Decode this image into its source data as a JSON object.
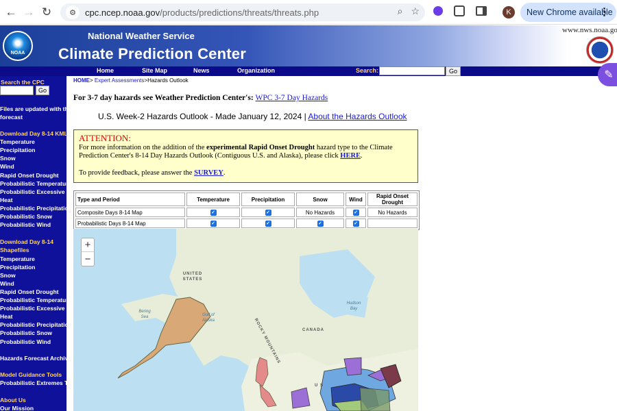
{
  "browser": {
    "url_host": "cpc.ncep.noaa.gov",
    "url_path": "/products/predictions/threats/threats.php",
    "profile_initial": "K",
    "update_label": "New Chrome available"
  },
  "header": {
    "logo_text": "NOAA",
    "agency": "National Weather Service",
    "title": "Climate Prediction Center",
    "site_url": "www.nws.noaa.gov"
  },
  "navbar": {
    "links": [
      "Home",
      "Site Map",
      "News",
      "Organization"
    ],
    "search_label": "Search:",
    "go_label": "Go"
  },
  "sidebar": {
    "search_label": "Search the CPC",
    "go_label": "Go",
    "items": [
      {
        "label": "Files are updated with the",
        "head": false
      },
      {
        "label": "forecast",
        "head": false
      },
      {
        "label": "Download Day 8-14 KML",
        "head": true
      },
      {
        "label": "Temperature",
        "head": false
      },
      {
        "label": "Precipitation",
        "head": false
      },
      {
        "label": "Snow",
        "head": false
      },
      {
        "label": "Wind",
        "head": false
      },
      {
        "label": "Rapid Onset Drought",
        "head": false
      },
      {
        "label": "Probabilistic Temperature",
        "head": false
      },
      {
        "label": "Probabilistic Excessive",
        "head": false
      },
      {
        "label": "Heat",
        "head": false
      },
      {
        "label": "Probabilistic Precipitation",
        "head": false
      },
      {
        "label": "Probabilistic Snow",
        "head": false
      },
      {
        "label": "Probabilistic Wind",
        "head": false
      },
      {
        "label": "Download Day 8-14",
        "head": true
      },
      {
        "label": "Shapefiles",
        "head": true
      },
      {
        "label": "Temperature",
        "head": false
      },
      {
        "label": "Precipitation",
        "head": false
      },
      {
        "label": "Snow",
        "head": false
      },
      {
        "label": "Wind",
        "head": false
      },
      {
        "label": "Rapid Onset Drought",
        "head": false
      },
      {
        "label": "Probabilistic Temperature",
        "head": false
      },
      {
        "label": "Probabilistic Excessive",
        "head": false
      },
      {
        "label": "Heat",
        "head": false
      },
      {
        "label": "Probabilistic Precipitation",
        "head": false
      },
      {
        "label": "Probabilistic Snow",
        "head": false
      },
      {
        "label": "Probabilistic Wind",
        "head": false
      },
      {
        "label": "Hazards Forecast Archives",
        "head": false
      },
      {
        "label": "Model Guidance Tools",
        "head": true
      },
      {
        "label": "Probabilistic Extremes Tool",
        "head": false
      },
      {
        "label": "About Us",
        "head": true
      },
      {
        "label": "Our Mission",
        "head": false
      }
    ]
  },
  "breadcrumb": {
    "home": "HOME",
    "sep": ">",
    "expert": "Expert Assessments",
    "current": "Hazards Outlook"
  },
  "wpc": {
    "prefix": "For 3-7 day hazards see Weather Prediction Center's:",
    "link": "WPC 3-7 Day Hazards"
  },
  "outlook": {
    "title": "U.S. Week-2 Hazards Outlook - Made January 12, 2024",
    "sep": "|",
    "about_link": "About the Hazards Outlook"
  },
  "attention": {
    "heading": "ATTENTION:",
    "text1": "For more information on the addition of the",
    "text_bold": "experimental Rapid Onset Drought",
    "text2": "hazard type to the Climate Prediction Center's 8-14 Day Hazards Outlook (Contiguous U.S. and Alaska), please click",
    "here_link": "HERE",
    "feedback": "To provide feedback, please answer the",
    "survey_link": "SURVEY"
  },
  "table": {
    "headers": [
      "Type and Period",
      "Temperature",
      "Precipitation",
      "Snow",
      "Wind",
      "Rapid Onset Drought"
    ],
    "rows": [
      {
        "label": "Composite Days 8-14 Map",
        "temperature": true,
        "precipitation": true,
        "snow": "No Hazards",
        "wind": true,
        "drought": "No Hazards"
      },
      {
        "label": "Probabilistic Days 8-14 Map",
        "temperature": true,
        "precipitation": true,
        "snow": true,
        "wind": true,
        "drought": ""
      }
    ]
  },
  "map": {
    "zoom_in": "+",
    "zoom_out": "−",
    "labels": {
      "united_states": "UNITED STATES",
      "canada": "CANADA",
      "rocky_mountains": "ROCKY MOUNTAINS",
      "bering_sea": "Bering Sea",
      "gulf_of_alaska": "Gulf of Alaska",
      "hudson_bay": "Hudson Bay",
      "us_partial": "U S"
    }
  }
}
